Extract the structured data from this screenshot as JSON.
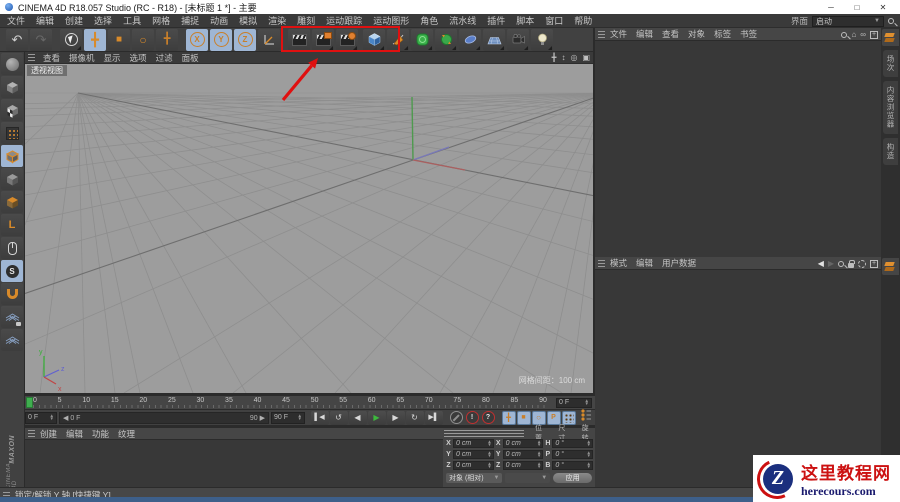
{
  "window": {
    "title": "CINEMA 4D R18.057 Studio (RC - R18) - [未标题 1 *] - 主要",
    "controls": {
      "minimize": "─",
      "maximize": "□",
      "close": "✕"
    }
  },
  "menubar": {
    "items": [
      "文件",
      "编辑",
      "创建",
      "选择",
      "工具",
      "网格",
      "捕捉",
      "动画",
      "模拟",
      "渲染",
      "雕刻",
      "运动跟踪",
      "运动图形",
      "角色",
      "流水线",
      "插件",
      "脚本",
      "窗口",
      "帮助"
    ],
    "interface_label": "界面",
    "interface_value": "启动"
  },
  "toolbar": {
    "undo_glyph": "↶",
    "redo_glyph": "↷",
    "move_glyph": "╋",
    "scale_glyph": "■",
    "rotate_glyph": "○",
    "last_tool_glyph": "╋",
    "axis_x": "X",
    "axis_y": "Y",
    "axis_z": "Z"
  },
  "left_palette": {
    "workplane_label": "L",
    "snap_label": "S"
  },
  "viewport": {
    "menu": [
      "查看",
      "摄像机",
      "显示",
      "选项",
      "过滤",
      "面板"
    ],
    "view_label": "透视视图",
    "grid_spacing": "网格间距：100 cm",
    "axis_x": "x",
    "axis_y": "y",
    "axis_z": "z",
    "nav_pan": "╋",
    "nav_zoom": "↕",
    "nav_rotate": "◎",
    "nav_toggle": "▣"
  },
  "object_manager": {
    "menu": [
      "文件",
      "编辑",
      "查看",
      "对象",
      "标签",
      "书签"
    ],
    "home_glyph": "⌂",
    "link_glyph": "∞",
    "plus_glyph": "+"
  },
  "right_tabs": [
    "场次",
    "内容浏览器",
    "构造"
  ],
  "attribute_manager": {
    "menu": [
      "模式",
      "编辑",
      "用户数据"
    ],
    "back_glyph": "◀",
    "forward_glyph": "▶",
    "plus_glyph": "+"
  },
  "timeline": {
    "ticks": [
      "0",
      "5",
      "10",
      "15",
      "20",
      "25",
      "30",
      "35",
      "40",
      "45",
      "50",
      "55",
      "60",
      "65",
      "70",
      "75",
      "80",
      "85",
      "90"
    ],
    "ruler_end_value": "0 F",
    "current_frame": "0 F",
    "range_start": "◀ 0 F",
    "range_end": "90 ▶",
    "end_frame": "90 F"
  },
  "transport": {
    "goto_start_glyph": "▌◀",
    "play_backward_glyph": "↺",
    "prev_frame_glyph": "◀",
    "play_glyph": "▶",
    "next_frame_glyph": "▶",
    "loop_glyph": "↻",
    "goto_end_glyph": "▶▌",
    "record_auto_glyph": "!",
    "record_help_glyph": "?",
    "key_position_glyph": "╋",
    "key_scale_glyph": "■",
    "key_rotation_glyph": "○",
    "key_parameter_glyph": "P"
  },
  "material_manager": {
    "menu": [
      "创建",
      "编辑",
      "功能",
      "纹理"
    ]
  },
  "coordinates": {
    "headers": [
      "位置",
      "尺寸",
      "旋转"
    ],
    "rows": [
      {
        "a": "X",
        "av": "0 cm",
        "b": "X",
        "bv": "0 cm",
        "c": "H",
        "cv": "0 °"
      },
      {
        "a": "Y",
        "av": "0 cm",
        "b": "Y",
        "bv": "0 cm",
        "c": "P",
        "cv": "0 °"
      },
      {
        "a": "Z",
        "av": "0 cm",
        "b": "Z",
        "bv": "0 cm",
        "c": "B",
        "cv": "0 °"
      }
    ],
    "mode_dropdown": "对象 (相对)",
    "apply_button": "应用"
  },
  "status_bar": {
    "text": "锁定/解锁 Y 轴 [快捷键 Y]"
  },
  "branding": {
    "line1": "MAXON",
    "line2": "CINEMA 4D"
  },
  "watermark": {
    "letter": "Z",
    "site_name": "这里教程网",
    "site_url": "herecours.com"
  },
  "colors": {
    "accent_orange": "#d88a2a",
    "active_blue": "#9fb6d4",
    "annotation_red": "#e01010",
    "viewport_gray": "#9d9d9d"
  }
}
